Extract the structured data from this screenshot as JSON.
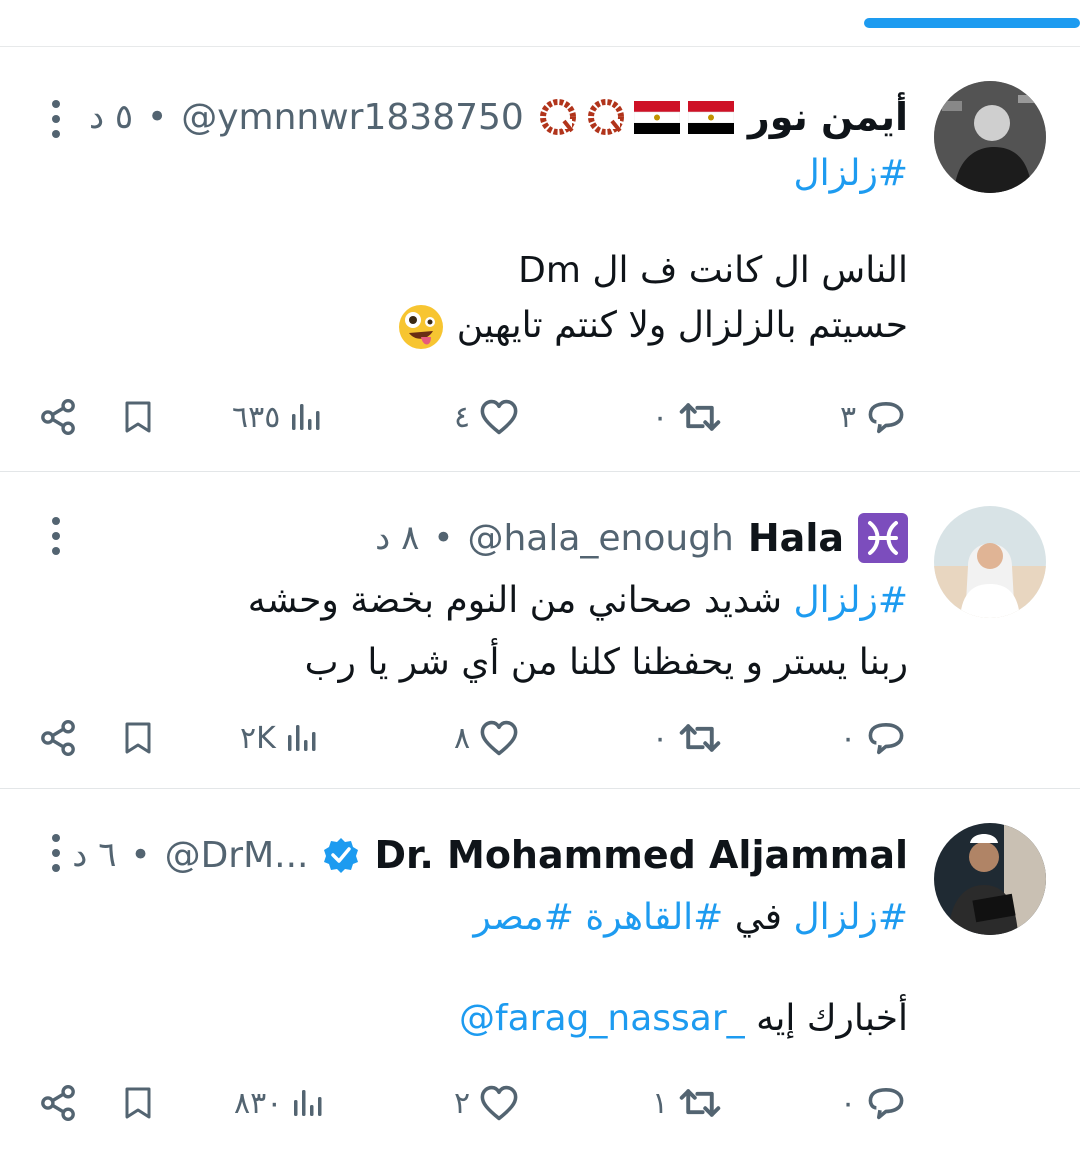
{
  "tweets": [
    {
      "name": "أيمن نور",
      "handle": "@ymnnwr1838750",
      "separator": "•",
      "time": "٥ د",
      "hashtag": "#زلزال",
      "lines": [
        "الناس ال كانت ف ال Dm",
        "حسيتم بالزلزال ولا كنتم تايهين"
      ],
      "replies": "٣",
      "retweets": "٠",
      "likes": "٤",
      "views": "٦٣٥"
    },
    {
      "name": "Hala",
      "handle": "@hala_enough",
      "separator": "•",
      "time": "٨ د",
      "hashtag": "#زلزال",
      "line1_text": " شديد صحاني من النوم بخضة وحشه",
      "line2": "ربنا يستر و يحفظنا كلنا من أي شر يا رب",
      "replies": "٠",
      "retweets": "٠",
      "likes": "٨",
      "views": "٢K"
    },
    {
      "name": "Dr. Mohammed Aljammal",
      "handle": "@DrM...",
      "separator": "•",
      "time": "٦ د",
      "hashtag1": "#زلزال",
      "word_in": " في ",
      "hashtag2": "#القاهرة",
      "hashtag3": "#مصر",
      "line2_text": "أخبارك إيه ",
      "mention": "@farag_nassar_",
      "replies": "٠",
      "retweets": "١",
      "likes": "٢",
      "views": "٨٣٠"
    }
  ],
  "icons": [
    "more-icon",
    "reply-icon",
    "retweet-icon",
    "like-icon",
    "views-icon",
    "bookmark-icon",
    "share-icon",
    "verified-icon",
    "pisces-icon",
    "flag-egypt-icon",
    "prayer-beads-icon",
    "zany-face-icon"
  ],
  "colors": {
    "accent": "#1d9bf0",
    "muted": "#536471",
    "text": "#0f1419"
  }
}
